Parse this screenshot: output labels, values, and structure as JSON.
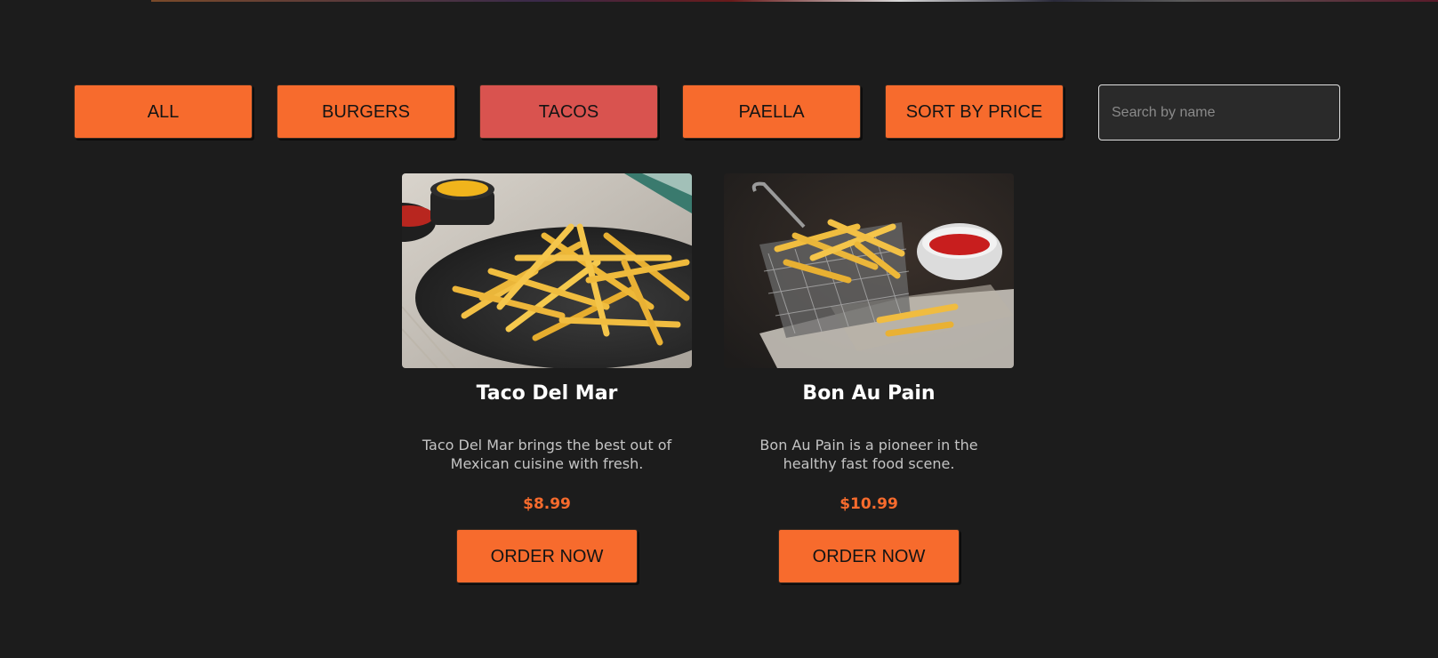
{
  "filters": {
    "all": "ALL",
    "burgers": "BURGERS",
    "tacos": "TACOS",
    "paella": "PAELLA",
    "sort_price": "SORT BY PRICE",
    "active": "TACOS"
  },
  "search": {
    "placeholder": "Search by name",
    "value": ""
  },
  "colors": {
    "background": "#1c1c1c",
    "accent": "#f76b2d",
    "active_filter": "#d9534f",
    "price": "#f76b2d"
  },
  "cards": [
    {
      "image_icon": "fries-on-slate-plate-photo",
      "title": "Taco Del Mar",
      "description": "Taco Del Mar brings the best out of Mexican cuisine with fresh.",
      "price": "$8.99",
      "button": "ORDER NOW"
    },
    {
      "image_icon": "fries-in-basket-with-ketchup-photo",
      "title": "Bon Au Pain",
      "description": "Bon Au Pain is a pioneer in the healthy fast food scene.",
      "price": "$10.99",
      "button": "ORDER NOW"
    }
  ]
}
